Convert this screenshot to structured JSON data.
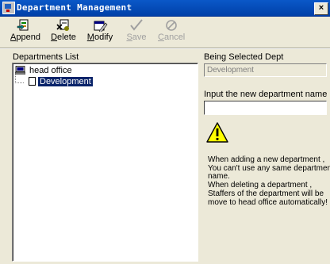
{
  "window": {
    "title": "Department Management",
    "close_glyph": "×",
    "icon": "app-icon"
  },
  "toolbar": {
    "buttons": [
      {
        "label_mnemonic": "A",
        "label_rest": "ppend",
        "icon": "append-icon",
        "enabled": true
      },
      {
        "label_mnemonic": "D",
        "label_rest": "elete",
        "icon": "delete-icon",
        "enabled": true
      },
      {
        "label_mnemonic": "M",
        "label_rest": "odify",
        "icon": "modify-icon",
        "enabled": true
      },
      {
        "label_mnemonic": "S",
        "label_rest": "ave",
        "icon": "checkmark-icon",
        "enabled": false
      },
      {
        "label_mnemonic": "C",
        "label_rest": "ancel",
        "icon": "cancel-icon",
        "enabled": false
      }
    ]
  },
  "departments": {
    "label": "Departments List",
    "root": {
      "name": "head office",
      "icon": "computer-icon"
    },
    "children": [
      {
        "name": "Development",
        "icon": "document-icon",
        "selected": true
      }
    ]
  },
  "details": {
    "selected_label": "Being Selected Dept",
    "selected_value": "Development",
    "new_name_label": "Input the new department name",
    "new_name_value": "",
    "warning_icon": "warning-icon",
    "notes": [
      "When adding a new department ,",
      "You can't use any same departmen",
      "name.",
      "When deleting a department ,",
      "Staffers of the department will be",
      "move to head office automatically!"
    ]
  },
  "colors": {
    "titlebar": "#0a58c8",
    "selection": "#0a246a",
    "face": "#ece9d8"
  }
}
